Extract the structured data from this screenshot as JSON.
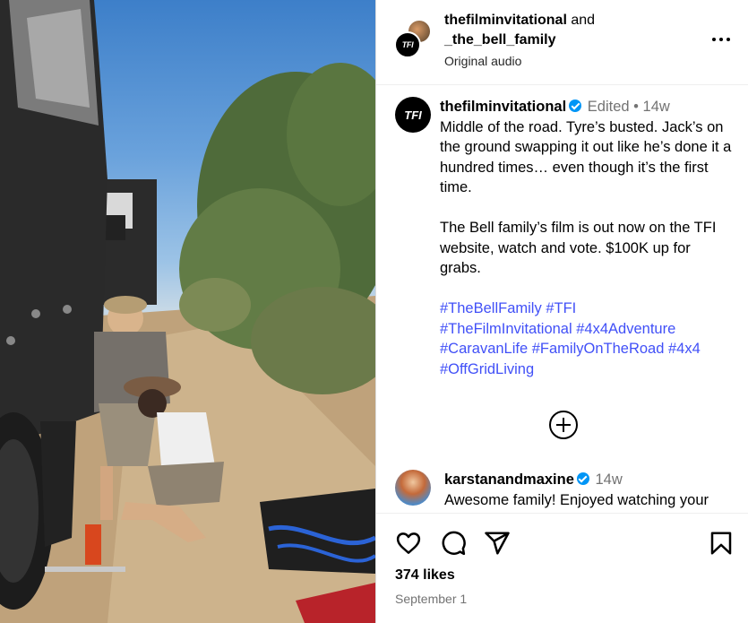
{
  "header": {
    "user1": "thefilminvitational",
    "joiner": "and",
    "user2": "_the_bell_family",
    "audio": "Original audio",
    "avatar_text": "TFI"
  },
  "caption": {
    "avatar_text": "TFI",
    "username": "thefilminvitational",
    "edited": "Edited",
    "dot": "•",
    "age": "14w",
    "paragraph1": "Middle of the road. Tyre’s busted. Jack’s on the ground swapping it out like he’s done it a hundred times… even though it’s the first time.",
    "paragraph2": "The Bell family’s film is out now on the TFI website, watch and vote. $100K up for grabs.",
    "hashtags": [
      "#TheBellFamily",
      "#TFI",
      "#TheFilmInvitational",
      "#4x4Adventure",
      "#CaravanLife",
      "#FamilyOnTheRoad",
      "#4x4",
      "#OffGridLiving"
    ]
  },
  "comment": {
    "username": "karstanandmaxine",
    "age": "14w",
    "text": "Awesome family! Enjoyed watching your"
  },
  "footer": {
    "likes": "374 likes",
    "date": "September 1"
  },
  "icons": {
    "more": "more-options-icon",
    "add": "add-comment-icon",
    "like": "heart-icon",
    "comment": "comment-icon",
    "share": "share-icon",
    "save": "bookmark-icon"
  },
  "colors": {
    "hashtag": "#4150f7",
    "verified": "#0095f6",
    "muted": "#737373"
  }
}
